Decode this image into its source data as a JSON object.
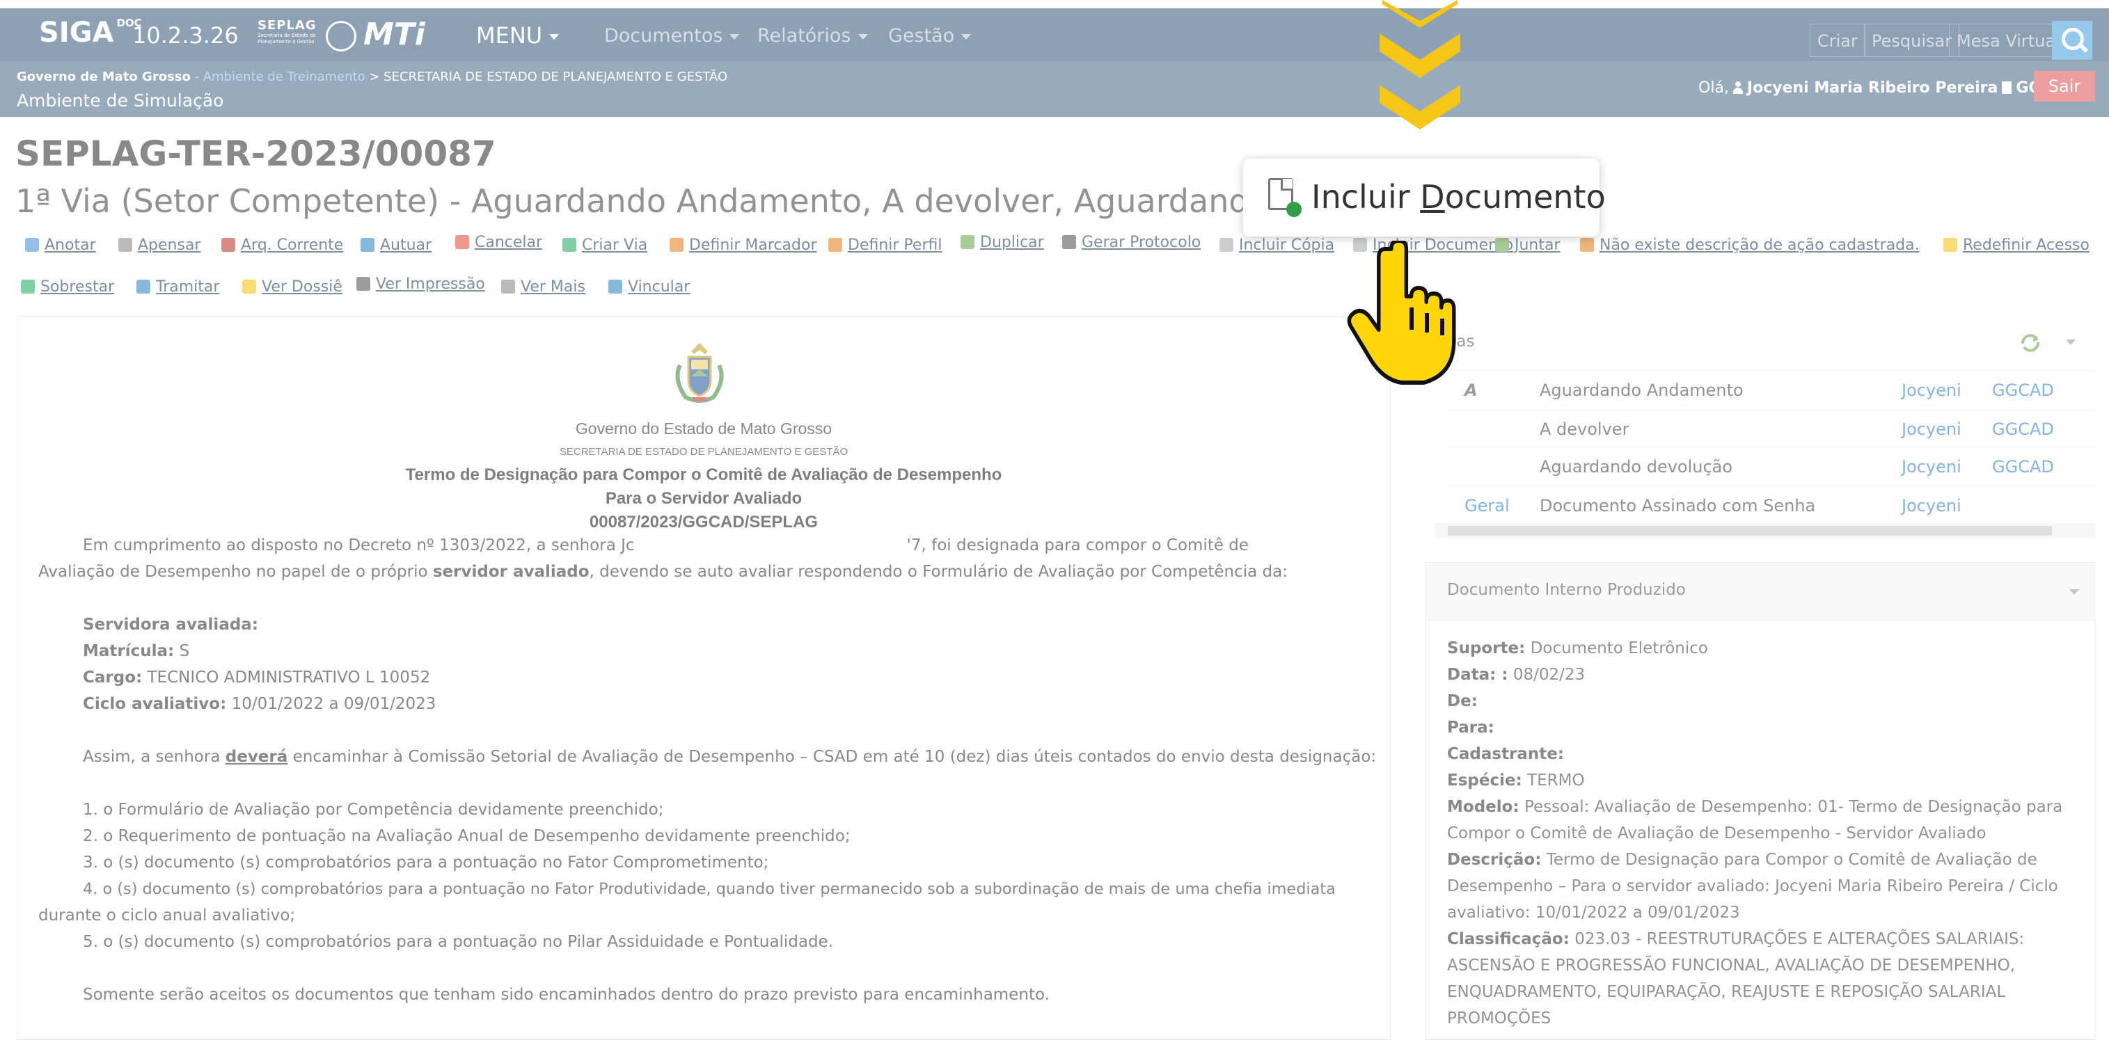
{
  "navbar": {
    "brand": "SIGA",
    "brand_sup": "DOC",
    "version": "10.2.3.26",
    "seplag_logo_text": "SEPLAG",
    "seplag_logo_sub": "Secretaria de Estado de Planejamento e Gestão",
    "mti_logo": "MTi",
    "menu_label": "MENU",
    "menus": [
      "Documentos",
      "Relatórios",
      "Gestão"
    ],
    "right_buttons": [
      "Criar",
      "Pesquisar",
      "Mesa Virtual"
    ]
  },
  "subbar": {
    "org": "Governo de Mato Grosso",
    "env": " - Ambiente de Treinamento",
    "dept": " > SECRETARIA DE ESTADO DE PLANEJAMENTO E GESTÃO",
    "ambiente": "Ambiente de Simulação",
    "greeting": "Olá,",
    "user_name": "Jocyeni Maria Ribeiro Pereira",
    "user_unit": "GGCAD",
    "logout": "Sair"
  },
  "document": {
    "code": "SEPLAG-TER-2023/00087",
    "via_status": "1ª Via (Setor Competente) - Aguardando Andamento, A devolver, Aguardando devoluç"
  },
  "actions": [
    "Anotar",
    "Apensar",
    "Arq. Corrente",
    "Autuar",
    "Cancelar",
    "Criar Via",
    "Definir Marcador",
    "Definir Perfil",
    "Duplicar",
    "Gerar Protocolo",
    "Incluir Cópia",
    "Incluir Documento",
    "Juntar",
    "Não existe descrição de ação cadastrada.",
    "Redefinir Acesso",
    "Sobrestar",
    "Tramitar",
    "Ver Dossiê",
    "Ver Impressão",
    "Ver Mais",
    "Vincular"
  ],
  "doc_content": {
    "gov": "Governo do Estado de Mato Grosso",
    "sec": "SECRETARIA DE ESTADO DE PLANEJAMENTO E GESTÃO",
    "title_l1": "Termo de Designação para Compor o Comitê de Avaliação de Desempenho",
    "title_l2": "Para o Servidor Avaliado",
    "title_l3": "00087/2023/GGCAD/SEPLAG",
    "p1_a": "Em cumprimento ao disposto no Decreto nº 1303/2022, a senhora Jc",
    "p1_b": "'7, foi designada para compor o Comitê de",
    "p1_c": "Avaliação de Desempenho no papel de o próprio",
    "p1_bold": "servidor avaliado",
    "p1_d": ", devendo se auto avaliar respondendo o Formulário de Avaliação por Competência da:",
    "lbl_servidora": "Servidora avaliada:",
    "lbl_matricula": "Matrícula:",
    "matricula_val": "S",
    "lbl_cargo": "Cargo:",
    "cargo_val": "TECNICO ADMINISTRATIVO L 10052",
    "lbl_ciclo": "Ciclo avaliativo:",
    "ciclo_val": "10/01/2022 a 09/01/2023",
    "p2_a": "Assim, a senhora",
    "p2_bold": "deverá",
    "p2_b": "encaminhar à Comissão Setorial de Avaliação de Desempenho – CSAD em até 10 (dez) dias úteis contados do envio desta designação:",
    "li1": "1. o Formulário de Avaliação por Competência devidamente preenchido;",
    "li2": "2. o Requerimento de pontuação na Avaliação Anual de Desempenho devidamente preenchido;",
    "li3": "3. o (s) documento (s) comprobatórios para a pontuação no Fator Comprometimento;",
    "li4a": "4. o (s) documento (s) comprobatórios para a pontuação no Fator Produtividade, quando tiver permanecido sob a subordinação de mais de uma chefia imediata",
    "li4b": "durante o ciclo anual avaliativo;",
    "li5": "5. o (s) documento (s) comprobatórios para a pontuação no Pilar Assiduidade e Pontualidade.",
    "p3": "Somente serão aceitos os documentos que tenham sido encaminhados dentro do prazo previsto para encaminhamento."
  },
  "movements": {
    "title": "ias",
    "rows": [
      {
        "tag": "A",
        "status": "Aguardando Andamento",
        "user": "Jocyeni",
        "unit": "GGCAD"
      },
      {
        "tag": "",
        "status": "A devolver",
        "user": "Jocyeni",
        "unit": "GGCAD"
      },
      {
        "tag": "",
        "status": "Aguardando devolução",
        "user": "Jocyeni",
        "unit": "GGCAD"
      },
      {
        "tag": "Geral",
        "status": "Documento Assinado com Senha",
        "user": "Jocyeni",
        "unit": ""
      }
    ]
  },
  "info": {
    "title": "Documento Interno Produzido",
    "suporte_lbl": "Suporte:",
    "suporte_val": "Documento Eletrônico",
    "data_lbl": "Data: :",
    "data_val": "08/02/23",
    "de_lbl": "De:",
    "para_lbl": "Para:",
    "cad_lbl": "Cadastrante:",
    "especie_lbl": "Espécie:",
    "especie_val": "TERMO",
    "modelo_lbl": "Modelo:",
    "modelo_l1": "Pessoal: Avaliação de Desempenho: 01- Termo de Designação para",
    "modelo_l2": "Compor o Comitê de Avaliação de Desempenho - Servidor Avaliado",
    "desc_lbl": "Descrição:",
    "desc_l1": "Termo de Designação para Compor o Comitê de Avaliação de",
    "desc_l2": "Desempenho – Para o servidor avaliado: Jocyeni Maria Ribeiro Pereira / Ciclo",
    "desc_l3": "avaliativo: 10/01/2022 a 09/01/2023",
    "class_lbl": "Classificação:",
    "class_l1": "023.03 - REESTRUTURAÇÕES E ALTERAÇÕES SALARIAIS:",
    "class_l2": "ASCENSÃO E PROGRESSÃO FUNCIONAL, AVALIAÇÃO DE DESEMPENHO,",
    "class_l3": "ENQUADRAMENTO, EQUIPARAÇÃO, REAJUSTE E REPOSIÇÃO SALARIAL",
    "class_l4": "PROMOÇÕES"
  },
  "highlight": {
    "pre": "Incluir ",
    "accel": "D",
    "post": "ocumento"
  },
  "colors": {
    "navbar": "#3d5d7e",
    "subbar": "#4f6e8d",
    "link": "#2a7fc4",
    "arrow": "#f5c518",
    "hand": "#ffd60a"
  }
}
